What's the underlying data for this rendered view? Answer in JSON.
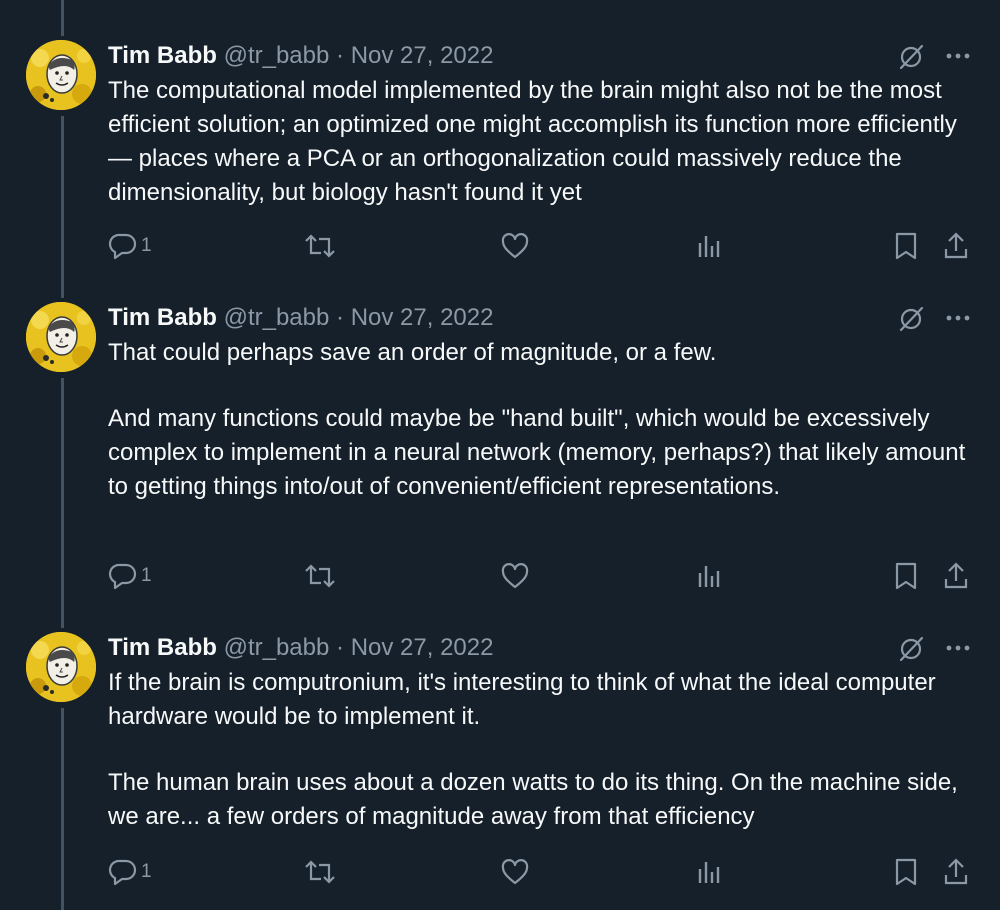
{
  "tweets": [
    {
      "author": "Tim Babb",
      "handle": "@tr_babb",
      "separator": "·",
      "date": "Nov 27, 2022",
      "paragraphs": [
        "The computational model implemented by the brain might also not be the most efficient solution; an optimized one might accomplish its function more efficiently— places where a PCA or an orthogonalization could massively reduce the dimensionality, but biology hasn't found it yet"
      ],
      "reply_count": "1"
    },
    {
      "author": "Tim Babb",
      "handle": "@tr_babb",
      "separator": "·",
      "date": "Nov 27, 2022",
      "paragraphs": [
        "That could perhaps save an order of magnitude, or a few.",
        "And many functions could maybe be \"hand built\", which would be excessively complex to implement in a neural network (memory, perhaps?) that likely amount to getting things into/out of convenient/efficient representations."
      ],
      "reply_count": "1"
    },
    {
      "author": "Tim Babb",
      "handle": "@tr_babb",
      "separator": "·",
      "date": "Nov 27, 2022",
      "paragraphs": [
        "If the brain is computronium, it's interesting to think of what the ideal computer hardware would be to implement it.",
        "The human brain uses about a dozen watts to do its thing. On the machine side, we are... a few orders of magnitude away from that efficiency"
      ],
      "reply_count": "1"
    }
  ],
  "icons": {
    "reply": "reply-icon",
    "retweet": "retweet-icon",
    "like": "heart-icon",
    "views": "views-icon",
    "bookmark": "bookmark-icon",
    "share": "share-icon",
    "grok": "grok-icon",
    "more": "more-icon"
  },
  "colors": {
    "background": "#15202b",
    "text": "#f7f9f9",
    "secondary": "#8b98a5",
    "thread_line": "#425364",
    "avatar": "#e8c21e"
  }
}
